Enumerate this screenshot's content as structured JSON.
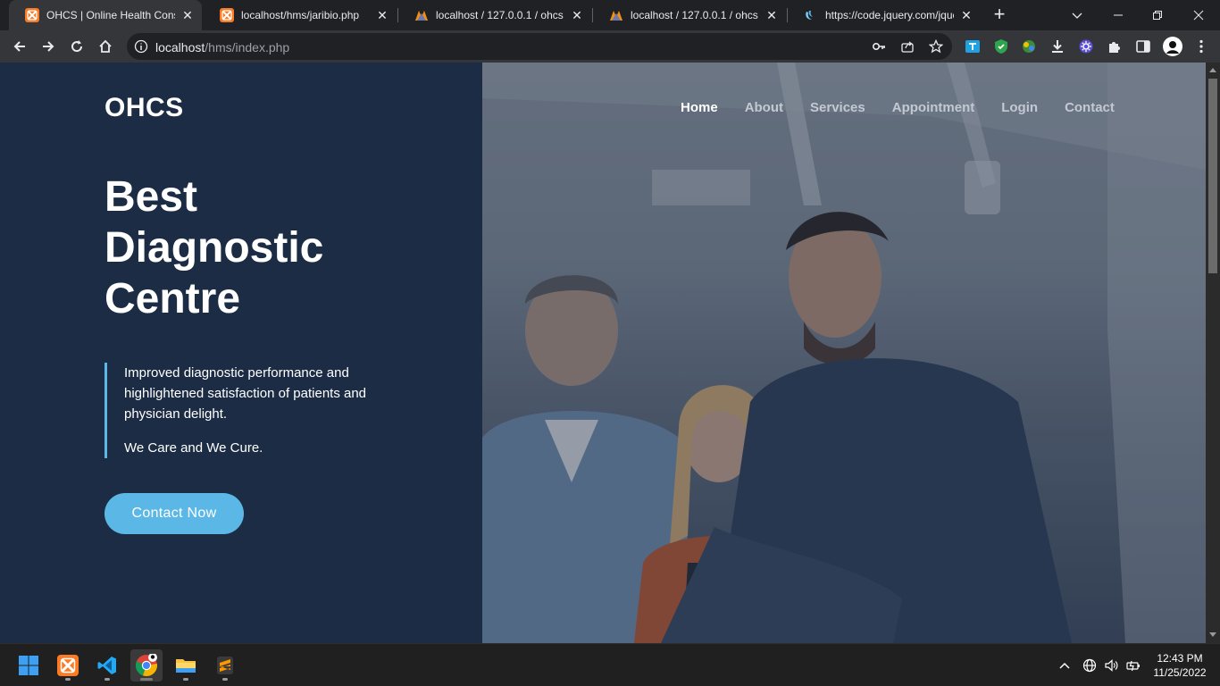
{
  "browser": {
    "tabs": [
      {
        "title": "OHCS | Online Health Consul",
        "icon": "xampp-icon",
        "active": true
      },
      {
        "title": "localhost/hms/jaribio.php",
        "icon": "xampp-icon",
        "active": false
      },
      {
        "title": "localhost / 127.0.0.1 / ohcs /",
        "icon": "phpmyadmin-icon",
        "active": false
      },
      {
        "title": "localhost / 127.0.0.1 / ohcs /",
        "icon": "phpmyadmin-icon",
        "active": false
      },
      {
        "title": "https://code.jquery.com/jque",
        "icon": "jquery-icon",
        "active": false
      }
    ],
    "url_host": "localhost",
    "url_path": "/hms/index.php"
  },
  "site": {
    "brand": "OHCS",
    "nav": [
      "Home",
      "About",
      "Services",
      "Appointment",
      "Login",
      "Contact"
    ],
    "hero_title_lines": [
      "Best",
      "Diagnostic",
      "Centre"
    ],
    "quote_text": "Improved diagnostic performance and highlightened satisfaction of patients and physician delight.",
    "quote_tagline": "We Care and We Cure.",
    "cta_label": "Contact Now",
    "accent_color": "#5bb8e6",
    "panel_color": "#1c2c44"
  },
  "taskbar": {
    "apps": [
      "windows-start-icon",
      "xampp-icon",
      "vscode-icon",
      "chrome-icon",
      "file-explorer-icon",
      "sublime-text-icon"
    ],
    "time": "12:43 PM",
    "date": "11/25/2022"
  }
}
